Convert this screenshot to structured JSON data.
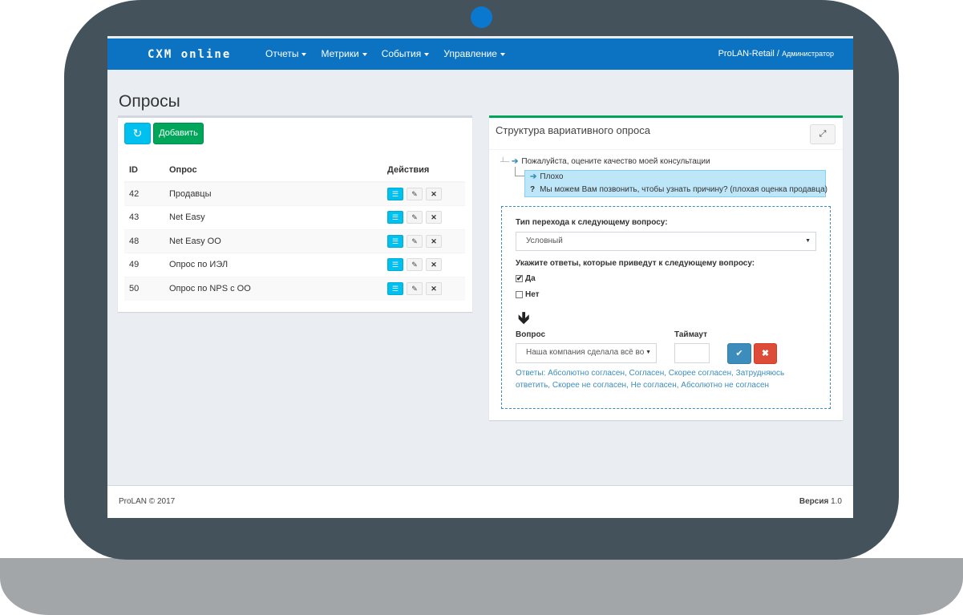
{
  "app": {
    "logo": "CXM online",
    "menu": [
      {
        "label": "Отчеты"
      },
      {
        "label": "Метрики"
      },
      {
        "label": "События"
      },
      {
        "label": "Управление"
      }
    ],
    "user": {
      "company": "ProLAN-Retail /",
      "role": "Администратор"
    }
  },
  "page": {
    "title": "Опросы"
  },
  "surveys": {
    "refresh_icon": "↻",
    "add_label": "Добавить",
    "columns": {
      "id": "ID",
      "name": "Опрос",
      "actions": "Действия"
    },
    "rows": [
      {
        "id": "42",
        "name": "Продавцы"
      },
      {
        "id": "43",
        "name": "Net Easy"
      },
      {
        "id": "48",
        "name": "Net Easy ОО"
      },
      {
        "id": "49",
        "name": "Опрос по ИЭЛ"
      },
      {
        "id": "50",
        "name": "Опрос по NPS с ОО"
      }
    ]
  },
  "structure": {
    "title": "Структура вариативного опроса",
    "expand_icon": "⤢",
    "root_question": "Пожалуйста, оцените качество моей консультации",
    "answer_node": "Плохо",
    "follow_question": "Мы можем Вам позвонить, чтобы узнать причину? (плохая оценка продавца)",
    "transition_label": "Тип перехода к следующему вопросу:",
    "transition_value": "Условный",
    "answers_label": "Укажите ответы, которые приведут к следующему вопросу:",
    "options": [
      {
        "label": "Да",
        "checked": true
      },
      {
        "label": "Нет",
        "checked": false
      }
    ],
    "question_label": "Вопрос",
    "question_value": "Наша компания сделала всё во",
    "timeout_label": "Таймаут",
    "timeout_value": "",
    "answers_text": "Ответы: Абсолютно согласен, Согласен, Скорее согласен, Затрудняюсь ответить, Скорее не согласен, Не согласен, Абсолютно не согласен"
  },
  "footer": {
    "copyright": "ProLAN © 2017",
    "version_label": "Версия",
    "version_value": "1.0"
  },
  "colors": {
    "navbar": "#0c73c2",
    "accent_blue": "#00c0ef",
    "success": "#00a65a",
    "danger": "#dd4b39",
    "bezel": "#44525b"
  }
}
